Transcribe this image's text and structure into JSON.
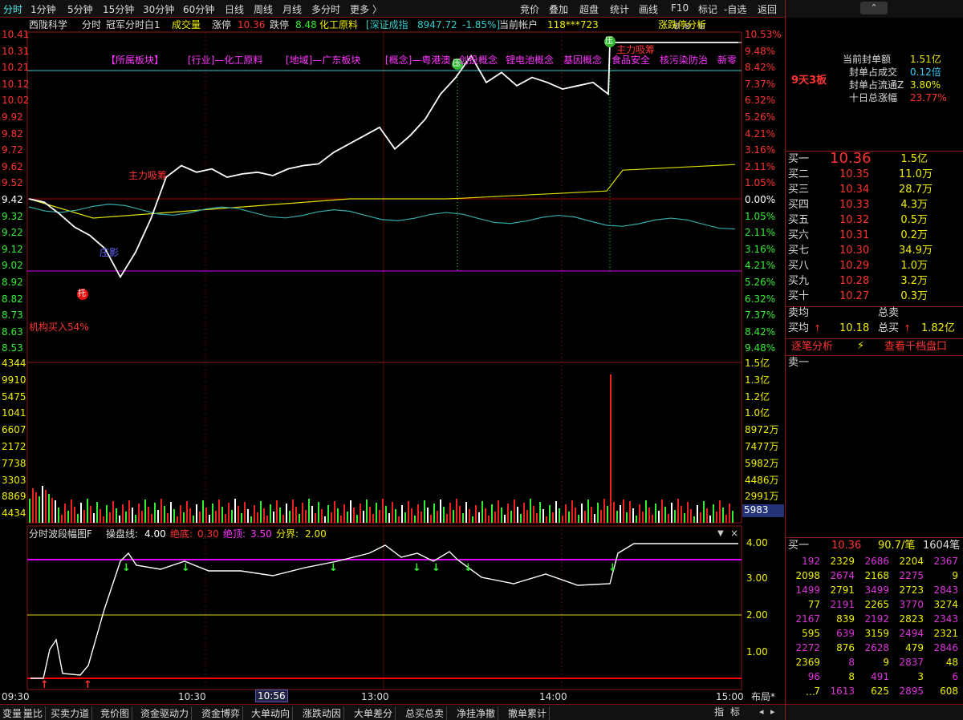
{
  "toolbar": {
    "tabs": [
      "分时",
      "1分钟",
      "5分钟",
      "15分钟",
      "30分钟",
      "60分钟",
      "日线",
      "周线",
      "月线",
      "多分时",
      "更多 〉"
    ],
    "right": [
      "竞价",
      "叠加",
      "超盘",
      "统计",
      "画线",
      "F10",
      "标记",
      "-自选",
      "返回"
    ]
  },
  "header": {
    "name": "西陇科学",
    "mode": "分时",
    "indicator": "冠军分时白1",
    "vol_label": "成交量",
    "zt_label": "涨停",
    "zt": "10.36",
    "dt_label": "跌停",
    "dt": "8.48",
    "sector": "化工原料",
    "index_name": "[深证成指",
    "index_val": "8947.72",
    "index_chg": "-1.85%]",
    "account_label": "当前帐户",
    "account": "118***723",
    "analysis": "涨跌停分析"
  },
  "concepts": [
    "【所属板块】",
    "[行业]—化工原料",
    "[地域]—广东板块",
    "[概念]—粤港澳",
    "创投概念",
    "锂电池概念",
    "基因概念",
    "食品安全",
    "核污染防治",
    "新零"
  ],
  "price_left": [
    "10.41",
    "10.31",
    "10.21",
    "10.12",
    "10.02",
    "9.92",
    "9.82",
    "9.72",
    "9.62",
    "9.52",
    "9.42",
    "9.32",
    "9.22",
    "9.12",
    "9.02",
    "8.92",
    "8.82",
    "8.73",
    "8.63",
    "8.53"
  ],
  "pct_right": [
    "10.53%",
    "9.48%",
    "8.42%",
    "7.37%",
    "6.32%",
    "5.26%",
    "4.21%",
    "3.16%",
    "2.11%",
    "1.05%",
    "0.00%",
    "1.05%",
    "2.11%",
    "3.16%",
    "4.21%",
    "5.26%",
    "6.32%",
    "7.37%",
    "8.42%",
    "9.48%"
  ],
  "vol_left": [
    "4344",
    "9910",
    "5475",
    "1041",
    "6607",
    "2172",
    "7738",
    "3303",
    "8869",
    "4434"
  ],
  "vol_right": [
    "1.5亿",
    "1.3亿",
    "1.2亿",
    "1.0亿",
    "8972万",
    "7477万",
    "5982万",
    "4486万",
    "2991万"
  ],
  "vol_current": "5983",
  "annotations": {
    "tuo": "托",
    "ya": "压",
    "inst": "机构买入54%",
    "zhuli": "主力吸筹",
    "zhuli2": "主力吸筹",
    "zuiying": "庄影"
  },
  "osc": {
    "title": "分时波段幅图F",
    "op_label": "操盘线:",
    "op": "4.00",
    "bottom_label": "绝底:",
    "bottom": "0.30",
    "top_label": "绝顶:",
    "top": "3.50",
    "div_label": "分界:",
    "div": "2.00",
    "scale": [
      "4.00",
      "3.00",
      "2.00",
      "1.00"
    ]
  },
  "time_axis": [
    "09:30",
    "10:30",
    "10:56",
    "13:00",
    "14:00",
    "15:00"
  ],
  "layout_btn": "布局*",
  "bottom_tabs": [
    "变量",
    "量比",
    "买卖力道",
    "竞价图",
    "资金驱动力",
    "资金博弈",
    "大单动向",
    "涨跌动因",
    "大单差分",
    "总买总卖",
    "净挂净撤",
    "撤单累计"
  ],
  "bottom_right": [
    "指",
    "标"
  ],
  "right_panel": {
    "board": "9天3板",
    "seal": [
      {
        "k": "当前封单额",
        "v": "1.51亿"
      },
      {
        "k": "封单占成交",
        "v": "0.12倍"
      },
      {
        "k": "封单占流通Z",
        "v": "3.80%"
      },
      {
        "k": "十日总涨幅",
        "v": "23.77%"
      }
    ],
    "bids": [
      {
        "k": "买一",
        "p": "10.36",
        "v": "1.5亿"
      },
      {
        "k": "买二",
        "p": "10.35",
        "v": "11.0万"
      },
      {
        "k": "买三",
        "p": "10.34",
        "v": "28.7万"
      },
      {
        "k": "买四",
        "p": "10.33",
        "v": "4.3万"
      },
      {
        "k": "买五",
        "p": "10.32",
        "v": "0.5万"
      },
      {
        "k": "买六",
        "p": "10.31",
        "v": "0.2万"
      },
      {
        "k": "买七",
        "p": "10.30",
        "v": "34.9万"
      },
      {
        "k": "买八",
        "p": "10.29",
        "v": "1.0万"
      },
      {
        "k": "买九",
        "p": "10.28",
        "v": "3.2万"
      },
      {
        "k": "买十",
        "p": "10.27",
        "v": "0.3万"
      }
    ],
    "avg": {
      "sell_avg": "卖均",
      "total_sell": "总卖",
      "buy_avg": "买均",
      "buy_avg_v": "10.18",
      "total_buy": "总买",
      "total_buy_v": "1.82亿"
    },
    "links": {
      "a": "逐笔分析",
      "b": "查看千档盘口"
    },
    "sell1": "卖一",
    "queue_hdr": {
      "k": "买一",
      "p": "10.36",
      "v": "90.7/笔",
      "n": "1604笔"
    },
    "queue": [
      [
        "192",
        "2329",
        "2686",
        "2204",
        "2367"
      ],
      [
        "2098",
        "2674",
        "2168",
        "2275",
        "9"
      ],
      [
        "1499",
        "2791",
        "3499",
        "2723",
        "2843"
      ],
      [
        "77",
        "2191",
        "2265",
        "3770",
        "3274"
      ],
      [
        "2167",
        "839",
        "2192",
        "2823",
        "2343"
      ],
      [
        "595",
        "639",
        "3159",
        "2494",
        "2321"
      ],
      [
        "2272",
        "876",
        "2628",
        "479",
        "2846"
      ],
      [
        "2369",
        "8",
        "9",
        "2837",
        "48"
      ],
      [
        "96",
        "8",
        "491",
        "3",
        "6"
      ],
      [
        "7",
        "1613",
        "625",
        "2895",
        "608"
      ]
    ],
    "more": "…"
  },
  "chart_data": {
    "type": "line",
    "series": [
      {
        "name": "价格",
        "note": "intraday price",
        "values": [
          9.42,
          9.4,
          9.33,
          9.25,
          9.2,
          9.12,
          8.95,
          9.1,
          9.3,
          9.55,
          9.62,
          9.58,
          9.6,
          9.55,
          9.57,
          9.58,
          9.56,
          9.6,
          9.62,
          9.63,
          9.7,
          9.75,
          9.8,
          9.85,
          9.72,
          9.8,
          9.9,
          10.05,
          10.15,
          10.28,
          10.12,
          10.18,
          10.1,
          10.15,
          10.12,
          10.08,
          10.1,
          10.12,
          10.05,
          10.36,
          10.36,
          10.36
        ]
      }
    ],
    "ylim": [
      8.48,
      10.36
    ]
  }
}
